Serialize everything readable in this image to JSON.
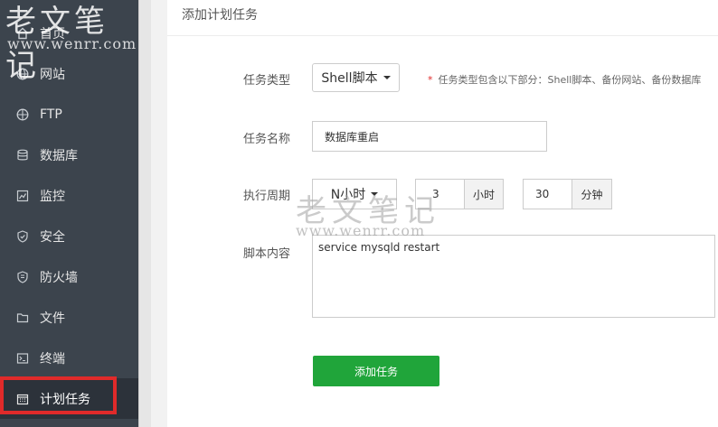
{
  "watermark": {
    "cn": "老文笔记",
    "url": "www.wenrr.com"
  },
  "sidebar": {
    "items": [
      {
        "label": "首页",
        "icon": "home-icon"
      },
      {
        "label": "网站",
        "icon": "globe-icon"
      },
      {
        "label": "FTP",
        "icon": "ftp-icon"
      },
      {
        "label": "数据库",
        "icon": "database-icon"
      },
      {
        "label": "监控",
        "icon": "monitor-icon"
      },
      {
        "label": "安全",
        "icon": "shield-icon"
      },
      {
        "label": "防火墙",
        "icon": "firewall-icon"
      },
      {
        "label": "文件",
        "icon": "folder-icon"
      },
      {
        "label": "终端",
        "icon": "terminal-icon"
      },
      {
        "label": "计划任务",
        "icon": "calendar-icon",
        "active": true
      }
    ]
  },
  "panel": {
    "title": "添加计划任务",
    "task_type": {
      "label": "任务类型",
      "value": "Shell脚本",
      "hint_star": "*",
      "hint": "任务类型包含以下部分：Shell脚本、备份网站、备份数据库"
    },
    "task_name": {
      "label": "任务名称",
      "value": "数据库重启"
    },
    "period": {
      "label": "执行周期",
      "type": "N小时",
      "hours": "3",
      "hours_unit": "小时",
      "minutes": "30",
      "minutes_unit": "分钟"
    },
    "script": {
      "label": "脚本内容",
      "value": "service mysqld restart"
    },
    "submit_label": "添加任务"
  },
  "colors": {
    "sidebar_bg": "#3c444d",
    "accent_green": "#20a53a",
    "highlight_red": "#e02a2a"
  }
}
